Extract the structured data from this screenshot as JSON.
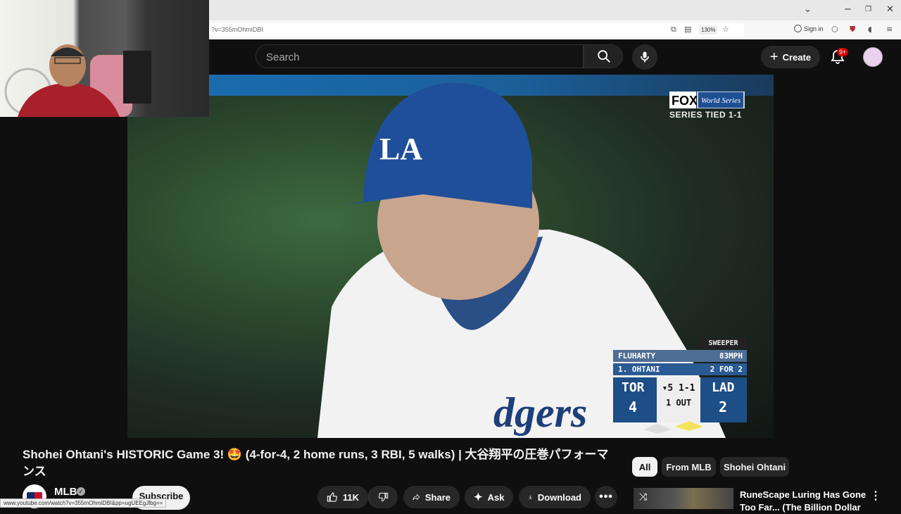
{
  "browser": {
    "url_partial": "?v=355mOhmiDBI",
    "zoom": "130%",
    "sign_in": "Sign in",
    "status_url": "www.youtube.com/watch?v=355mOhmiDBI&pp=ugUEEgJlbg=="
  },
  "header": {
    "search_placeholder": "Search",
    "create_label": "Create",
    "notifications_badge": "9+"
  },
  "video": {
    "network_logo": "FOX",
    "network_sub": "World Series",
    "series_status": "SERIES TIED 1-1",
    "scorebug": {
      "pitch_type": "SWEEPER",
      "pitcher": "FLUHARTY",
      "pitch_speed": "83MPH",
      "batter": "1. OHTANI",
      "batter_stats": "2 FOR 2",
      "away_team": "TOR",
      "away_runs": "4",
      "home_team": "LAD",
      "home_runs": "2",
      "inning": "▾5",
      "count": "1-1",
      "outs": "1 OUT"
    }
  },
  "info": {
    "title": "Shohei Ohtani's HISTORIC Game 3! 🤩 (4-for-4, 2 home runs, 3 RBI, 5 walks) | 大谷翔平の圧巻パフォーマンス",
    "channel": "MLB",
    "subscribe": "Subscribe",
    "likes": "11K",
    "share": "Share",
    "ask": "Ask",
    "download": "Download"
  },
  "chips": [
    "All",
    "From MLB",
    "Shohei Ohtani"
  ],
  "recommendation": {
    "title": "RuneScape Luring Has Gone Too Far... (The Billion Dollar"
  },
  "colors": {
    "background": "#0f0f0f",
    "notification": "#cc0000",
    "scorebug_blue": "#1d4e86"
  }
}
